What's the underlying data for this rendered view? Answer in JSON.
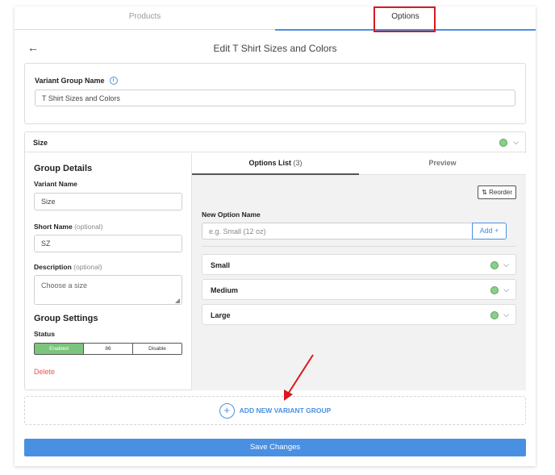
{
  "tabs": [
    {
      "label": "Products",
      "active": false
    },
    {
      "label": "Options",
      "active": true
    }
  ],
  "header": {
    "back_icon": "arrow-left-icon",
    "title": "Edit T Shirt Sizes and Colors"
  },
  "variant_group": {
    "label": "Variant Group Name",
    "info_icon": "i",
    "value": "T Shirt Sizes and Colors"
  },
  "size_panel": {
    "title": "Size",
    "status_color": "#8ad08a",
    "group_details": {
      "title": "Group Details",
      "variant_name_label": "Variant Name",
      "variant_name_value": "Size",
      "short_name_label": "Short Name",
      "short_name_optional": "(optional)",
      "short_name_value": "SZ",
      "description_label": "Description",
      "description_optional": "(optional)",
      "description_placeholder": "Choose a size"
    },
    "group_settings": {
      "title": "Group Settings",
      "status_label": "Status",
      "status_options": [
        "Enabled",
        "86",
        "Disable"
      ],
      "status_selected": "Enabled",
      "delete_label": "Delete"
    },
    "options_tabs": {
      "list_label": "Options List",
      "list_count": "(3)",
      "preview_label": "Preview"
    },
    "reorder_label": "Reorder",
    "reorder_icon": "⇅",
    "new_option": {
      "label": "New Option Name",
      "placeholder": "e.g. Small (12 oz)",
      "add_label": "Add +"
    },
    "options": [
      {
        "name": "Small"
      },
      {
        "name": "Medium"
      },
      {
        "name": "Large"
      }
    ]
  },
  "add_group_label": "ADD NEW VARIANT GROUP",
  "add_group_icon": "+",
  "save_label": "Save Changes",
  "colors": {
    "accent": "#4a90e2",
    "enabled": "#7cc47c",
    "delete": "#e05555",
    "annotation": "#d71920"
  }
}
